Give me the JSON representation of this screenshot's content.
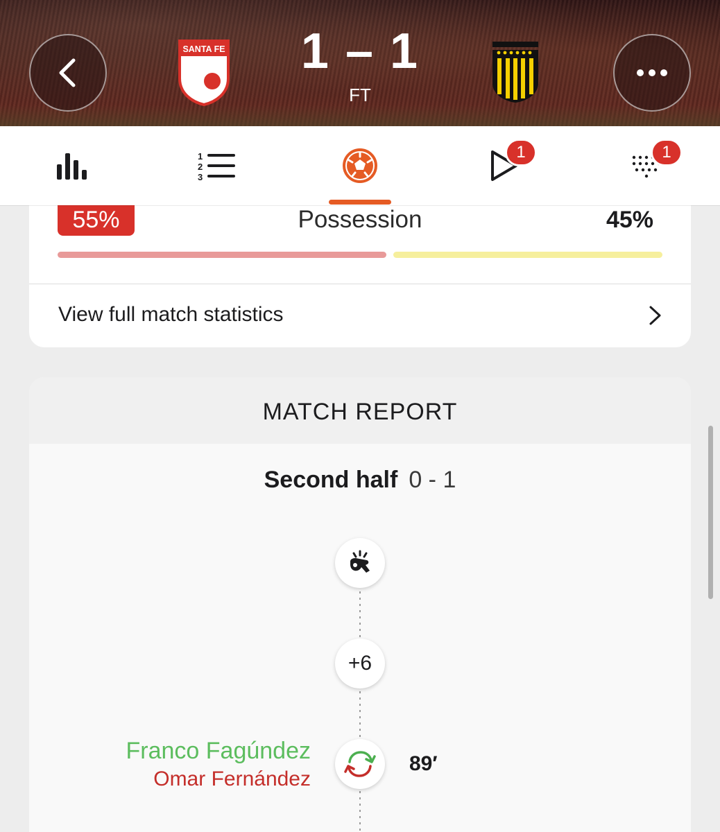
{
  "header": {
    "home_team": "Santa Fe",
    "home_crest_text": "SANTA FE",
    "away_team": "Peñarol",
    "score": "1 – 1",
    "status": "FT",
    "back_icon": "chevron-left-icon",
    "more_icon": "ellipsis-icon"
  },
  "tabs": [
    {
      "icon": "stats-bars-icon",
      "active": false
    },
    {
      "icon": "lineup-list-icon",
      "active": false
    },
    {
      "icon": "football-icon",
      "active": true
    },
    {
      "icon": "play-icon",
      "active": false,
      "badge": "1"
    },
    {
      "icon": "table-dots-icon",
      "active": false,
      "badge": "1"
    }
  ],
  "stats": {
    "possession_label": "Possession",
    "home_value": "55%",
    "away_value": "45%",
    "home_share": 55,
    "away_share": 45,
    "full_stats_label": "View full match statistics"
  },
  "report": {
    "title": "MATCH REPORT",
    "half_label": "Second half",
    "half_score": "0 - 1",
    "added_time": "+6",
    "events": [
      {
        "type": "substitution",
        "player_in": "Franco Fagúndez",
        "player_out": "Omar Fernández",
        "minute": "89′"
      }
    ]
  },
  "colors": {
    "accent": "#e55b24",
    "home": "#d8312a",
    "home_bar": "#e89a99",
    "away_bar": "#f6ef9d",
    "sub_in": "#5cbd5e",
    "sub_out": "#c42e2a"
  }
}
